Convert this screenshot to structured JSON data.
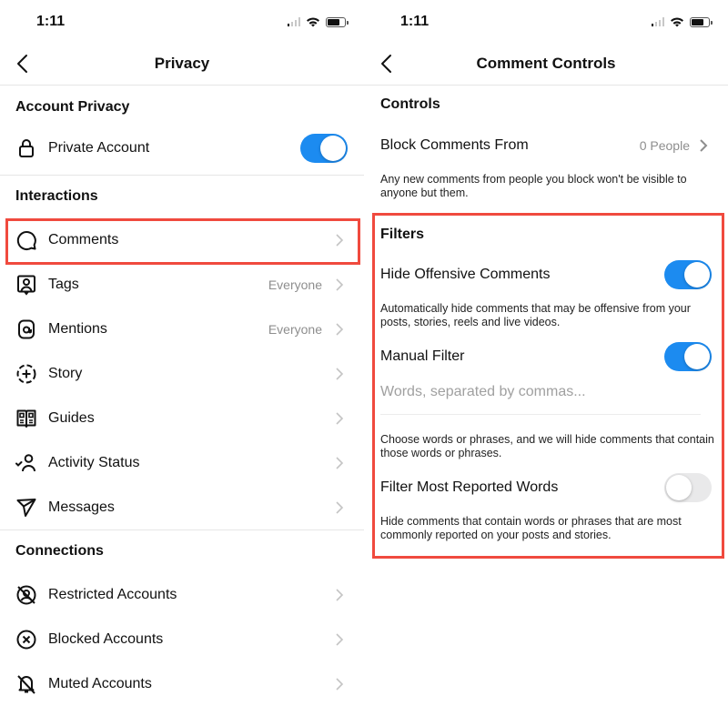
{
  "left": {
    "status_time": "1:11",
    "title": "Privacy",
    "sections": [
      {
        "header": "Account Privacy",
        "items": [
          {
            "label": "Private Account",
            "icon": "lock-icon",
            "toggle": true
          }
        ]
      },
      {
        "header": "Interactions",
        "items": [
          {
            "label": "Comments",
            "icon": "comment-icon",
            "value": ""
          },
          {
            "label": "Tags",
            "icon": "tag-person-icon",
            "value": "Everyone"
          },
          {
            "label": "Mentions",
            "icon": "at-sign-icon",
            "value": "Everyone"
          },
          {
            "label": "Story",
            "icon": "story-add-icon",
            "value": ""
          },
          {
            "label": "Guides",
            "icon": "guides-icon",
            "value": ""
          },
          {
            "label": "Activity Status",
            "icon": "activity-status-icon",
            "value": ""
          },
          {
            "label": "Messages",
            "icon": "paper-plane-icon",
            "value": ""
          }
        ]
      },
      {
        "header": "Connections",
        "items": [
          {
            "label": "Restricted Accounts",
            "icon": "restricted-icon",
            "value": ""
          },
          {
            "label": "Blocked Accounts",
            "icon": "blocked-icon",
            "value": ""
          },
          {
            "label": "Muted Accounts",
            "icon": "muted-bell-icon",
            "value": ""
          }
        ]
      }
    ]
  },
  "right": {
    "status_time": "1:11",
    "title": "Comment Controls",
    "controls_header": "Controls",
    "block_comments_label": "Block Comments From",
    "block_comments_value": "0 People",
    "block_comments_desc": "Any new comments from people you block won't be visible to anyone but them.",
    "filters_header": "Filters",
    "hide_offensive_label": "Hide Offensive Comments",
    "hide_offensive_on": true,
    "hide_offensive_desc": "Automatically hide comments that may be offensive from your posts, stories, reels and live videos.",
    "manual_filter_label": "Manual Filter",
    "manual_filter_on": true,
    "manual_filter_placeholder": "Words, separated by commas...",
    "manual_filter_value": "",
    "manual_filter_desc": "Choose words or phrases, and we will hide comments that contain those words or phrases.",
    "most_reported_label": "Filter Most Reported Words",
    "most_reported_on": false,
    "most_reported_desc": "Hide comments that contain words or phrases that are most commonly reported on your posts and stories."
  },
  "colors": {
    "toggle_on": "#1c8bf0",
    "toggle_off": "#e9e9ea",
    "highlight": "#f04a3e",
    "secondary_text": "#8e8e8e"
  }
}
